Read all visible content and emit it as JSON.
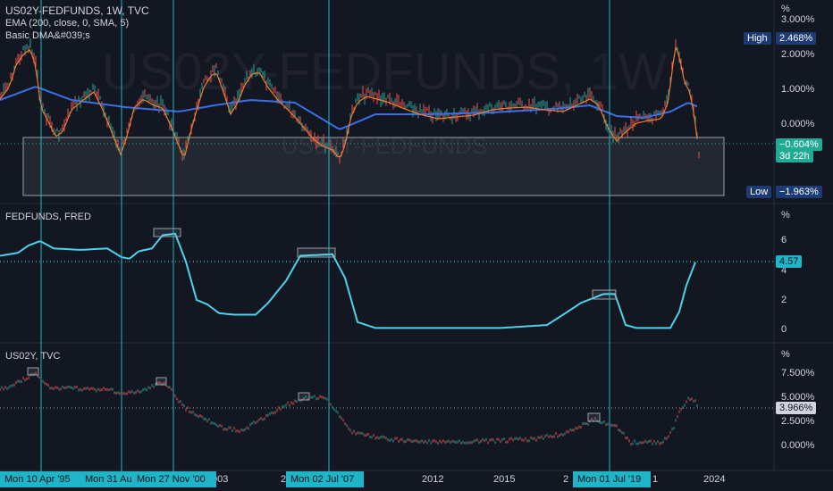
{
  "colors": {
    "background": "#131722",
    "grid": "#1e222d",
    "ema200": "#3b6fe8",
    "sma5": "#f57c2b",
    "price_up": "#26a69a",
    "price_down": "#ef5350",
    "fedfunds_line": "#4dd2ec",
    "vline": "#1fb5c8",
    "high_label_bg": "#1c3a73",
    "current_label_bg": "#22ab94"
  },
  "panes": {
    "main": {
      "symbol": "US02Y-FEDFUNDS, 1W, TVC",
      "indicator_1": "EMA (200, close, 0, SMA, 5)",
      "indicator_2": "Basic DMA&#039;s",
      "watermark_large": "US02Y-FEDFUNDS, 1W",
      "watermark_small": "US02Y-FEDFUNDS",
      "axis_unit": "%",
      "ticks": [
        "3.000%",
        "2.000%",
        "1.000%",
        "0.000%"
      ],
      "high_label": "High",
      "high_value": "2.468%",
      "low_label": "Low",
      "low_value": "−1.963%",
      "current_value": "−0.604%",
      "countdown": "3d 22h"
    },
    "fedfunds": {
      "title": "FEDFUNDS, FRED",
      "axis_unit": "%",
      "ticks": [
        "6",
        "4",
        "2",
        "0"
      ],
      "current_value": "4.57"
    },
    "us02y": {
      "title": "US02Y, TVC",
      "axis_unit": "%",
      "ticks": [
        "7.500%",
        "5.000%",
        "2.500%",
        "0.000%"
      ],
      "current_value": "3.966%"
    }
  },
  "x_axis": {
    "ticks": [
      "003",
      "2",
      "2012",
      "2015",
      "2",
      "1",
      "2024"
    ],
    "date_tags": [
      "Mon 10 Apr '95",
      "Mon 31 Au",
      "Mon 27 Nov '00",
      "Mon 02 Jul '07",
      "Mon 01 Jul '19"
    ]
  }
}
